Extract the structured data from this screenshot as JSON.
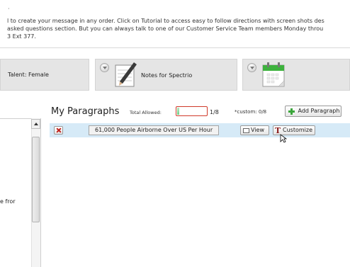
{
  "intro": {
    "bullet": "·",
    "lines": [
      "l to create your message in any order. Click on Tutorial to access easy to follow directions with screen shots des",
      " asked questions section. But you can always talk to one of our Customer Service Team members Monday throu",
      "3 Ext 377."
    ]
  },
  "cards": {
    "talent_label": "Talent: Female",
    "notes_label": "Notes for Spectrio",
    "notes_icon": "notepad-pencil-icon",
    "calendar_icon": "calendar-icon"
  },
  "sidebar": {
    "fragment_text": "e fror"
  },
  "paragraphs": {
    "title": "My Paragraphs",
    "total_allowed_label": "Total Allowed:",
    "used_fraction": 0.125,
    "count_text": "1/8",
    "custom_text": "*custom: 0/8",
    "add_button_label": "Add Paragraph",
    "rows": [
      {
        "title": "61,000 People Airborne Over US Per Hour",
        "view_label": "View",
        "customize_label": "Customize"
      }
    ]
  },
  "colors": {
    "row_highlight": "#d6eaf7",
    "meter_border": "#d03a2a",
    "meter_fill": "#6fcf88",
    "delete_x": "#c0201b",
    "plus_green": "#3aa63a"
  }
}
